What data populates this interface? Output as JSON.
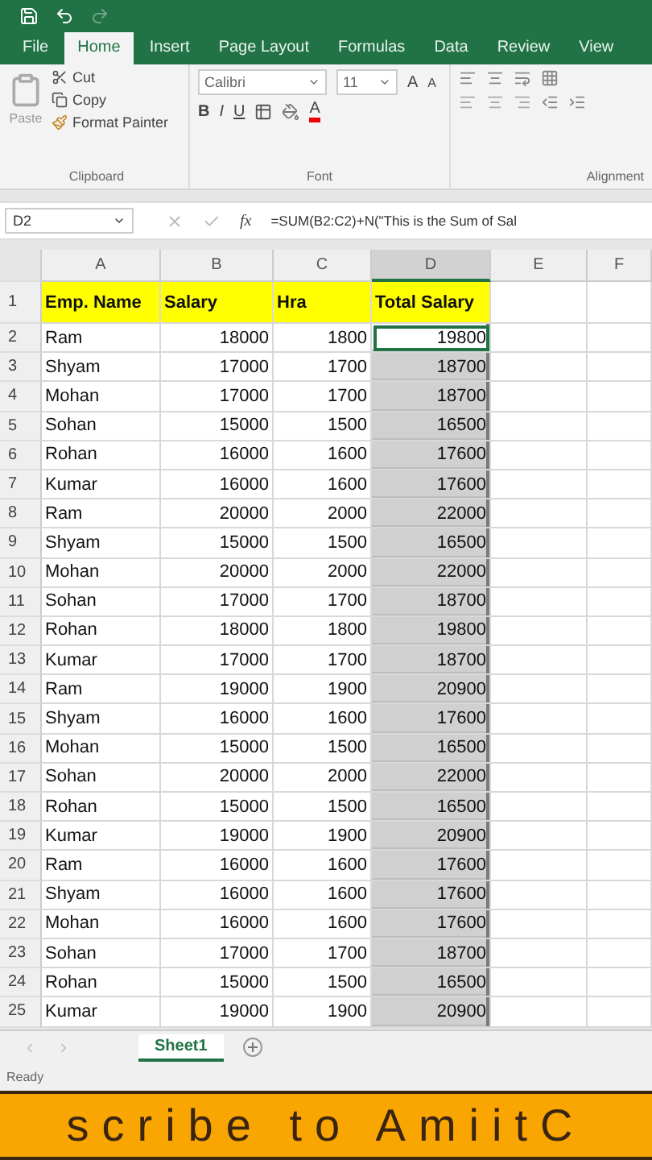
{
  "quick_access": {
    "redo": {
      "disabled": true
    }
  },
  "tabs": [
    {
      "label": "File",
      "selected": false
    },
    {
      "label": "Home",
      "selected": true
    },
    {
      "label": "Insert",
      "selected": false
    },
    {
      "label": "Page Layout",
      "selected": false
    },
    {
      "label": "Formulas",
      "selected": false
    },
    {
      "label": "Data",
      "selected": false
    },
    {
      "label": "Review",
      "selected": false
    },
    {
      "label": "View",
      "selected": false
    }
  ],
  "ribbon": {
    "clipboard": {
      "title": "Clipboard",
      "paste": "Paste",
      "cut": "Cut",
      "copy": "Copy",
      "format_painter": "Format Painter"
    },
    "font": {
      "title": "Font",
      "font_name": "Calibri",
      "font_size": "11",
      "grow": "A",
      "shrink": "A",
      "bold": "B",
      "italic": "I",
      "underline": "U",
      "font_color": "A"
    },
    "alignment": {
      "title": "Alignment"
    }
  },
  "formula_bar": {
    "name_box": "D2",
    "fx": "fx",
    "formula": "=SUM(B2:C2)+N(\"This is the Sum of Sal"
  },
  "columns": [
    {
      "label": "A",
      "selected": false
    },
    {
      "label": "B",
      "selected": false
    },
    {
      "label": "C",
      "selected": false
    },
    {
      "label": "D",
      "selected": true
    },
    {
      "label": "E",
      "selected": false
    },
    {
      "label": "F",
      "selected": false
    }
  ],
  "header_row": {
    "number": "1",
    "cells": [
      "Emp. Name",
      "Salary",
      "Hra",
      "Total Salary"
    ]
  },
  "rows": [
    {
      "number": "2",
      "cells": [
        "Ram",
        "18000",
        "1800",
        "19800"
      ],
      "selected": true,
      "active": true
    },
    {
      "number": "3",
      "cells": [
        "Shyam",
        "17000",
        "1700",
        "18700"
      ],
      "selected": true,
      "active": false
    },
    {
      "number": "4",
      "cells": [
        "Mohan",
        "17000",
        "1700",
        "18700"
      ],
      "selected": true,
      "active": false
    },
    {
      "number": "5",
      "cells": [
        "Sohan",
        "15000",
        "1500",
        "16500"
      ],
      "selected": true,
      "active": false
    },
    {
      "number": "6",
      "cells": [
        "Rohan",
        "16000",
        "1600",
        "17600"
      ],
      "selected": true,
      "active": false
    },
    {
      "number": "7",
      "cells": [
        "Kumar",
        "16000",
        "1600",
        "17600"
      ],
      "selected": true,
      "active": false
    },
    {
      "number": "8",
      "cells": [
        "Ram",
        "20000",
        "2000",
        "22000"
      ],
      "selected": true,
      "active": false
    },
    {
      "number": "9",
      "cells": [
        "Shyam",
        "15000",
        "1500",
        "16500"
      ],
      "selected": true,
      "active": false
    },
    {
      "number": "10",
      "cells": [
        "Mohan",
        "20000",
        "2000",
        "22000"
      ],
      "selected": true,
      "active": false
    },
    {
      "number": "11",
      "cells": [
        "Sohan",
        "17000",
        "1700",
        "18700"
      ],
      "selected": true,
      "active": false
    },
    {
      "number": "12",
      "cells": [
        "Rohan",
        "18000",
        "1800",
        "19800"
      ],
      "selected": true,
      "active": false
    },
    {
      "number": "13",
      "cells": [
        "Kumar",
        "17000",
        "1700",
        "18700"
      ],
      "selected": true,
      "active": false
    },
    {
      "number": "14",
      "cells": [
        "Ram",
        "19000",
        "1900",
        "20900"
      ],
      "selected": true,
      "active": false
    },
    {
      "number": "15",
      "cells": [
        "Shyam",
        "16000",
        "1600",
        "17600"
      ],
      "selected": true,
      "active": false
    },
    {
      "number": "16",
      "cells": [
        "Mohan",
        "15000",
        "1500",
        "16500"
      ],
      "selected": true,
      "active": false
    },
    {
      "number": "17",
      "cells": [
        "Sohan",
        "20000",
        "2000",
        "22000"
      ],
      "selected": true,
      "active": false
    },
    {
      "number": "18",
      "cells": [
        "Rohan",
        "15000",
        "1500",
        "16500"
      ],
      "selected": true,
      "active": false
    },
    {
      "number": "19",
      "cells": [
        "Kumar",
        "19000",
        "1900",
        "20900"
      ],
      "selected": true,
      "active": false
    },
    {
      "number": "20",
      "cells": [
        "Ram",
        "16000",
        "1600",
        "17600"
      ],
      "selected": true,
      "active": false
    },
    {
      "number": "21",
      "cells": [
        "Shyam",
        "16000",
        "1600",
        "17600"
      ],
      "selected": true,
      "active": false
    },
    {
      "number": "22",
      "cells": [
        "Mohan",
        "16000",
        "1600",
        "17600"
      ],
      "selected": true,
      "active": false
    },
    {
      "number": "23",
      "cells": [
        "Sohan",
        "17000",
        "1700",
        "18700"
      ],
      "selected": true,
      "active": false
    },
    {
      "number": "24",
      "cells": [
        "Rohan",
        "15000",
        "1500",
        "16500"
      ],
      "selected": true,
      "active": false
    },
    {
      "number": "25",
      "cells": [
        "Kumar",
        "19000",
        "1900",
        "20900"
      ],
      "selected": true,
      "active": false
    }
  ],
  "sheet_tabs": [
    {
      "label": "Sheet1",
      "selected": true
    }
  ],
  "status_bar": {
    "text": "Ready"
  },
  "banner": {
    "text": "scribe to AmiitC"
  }
}
